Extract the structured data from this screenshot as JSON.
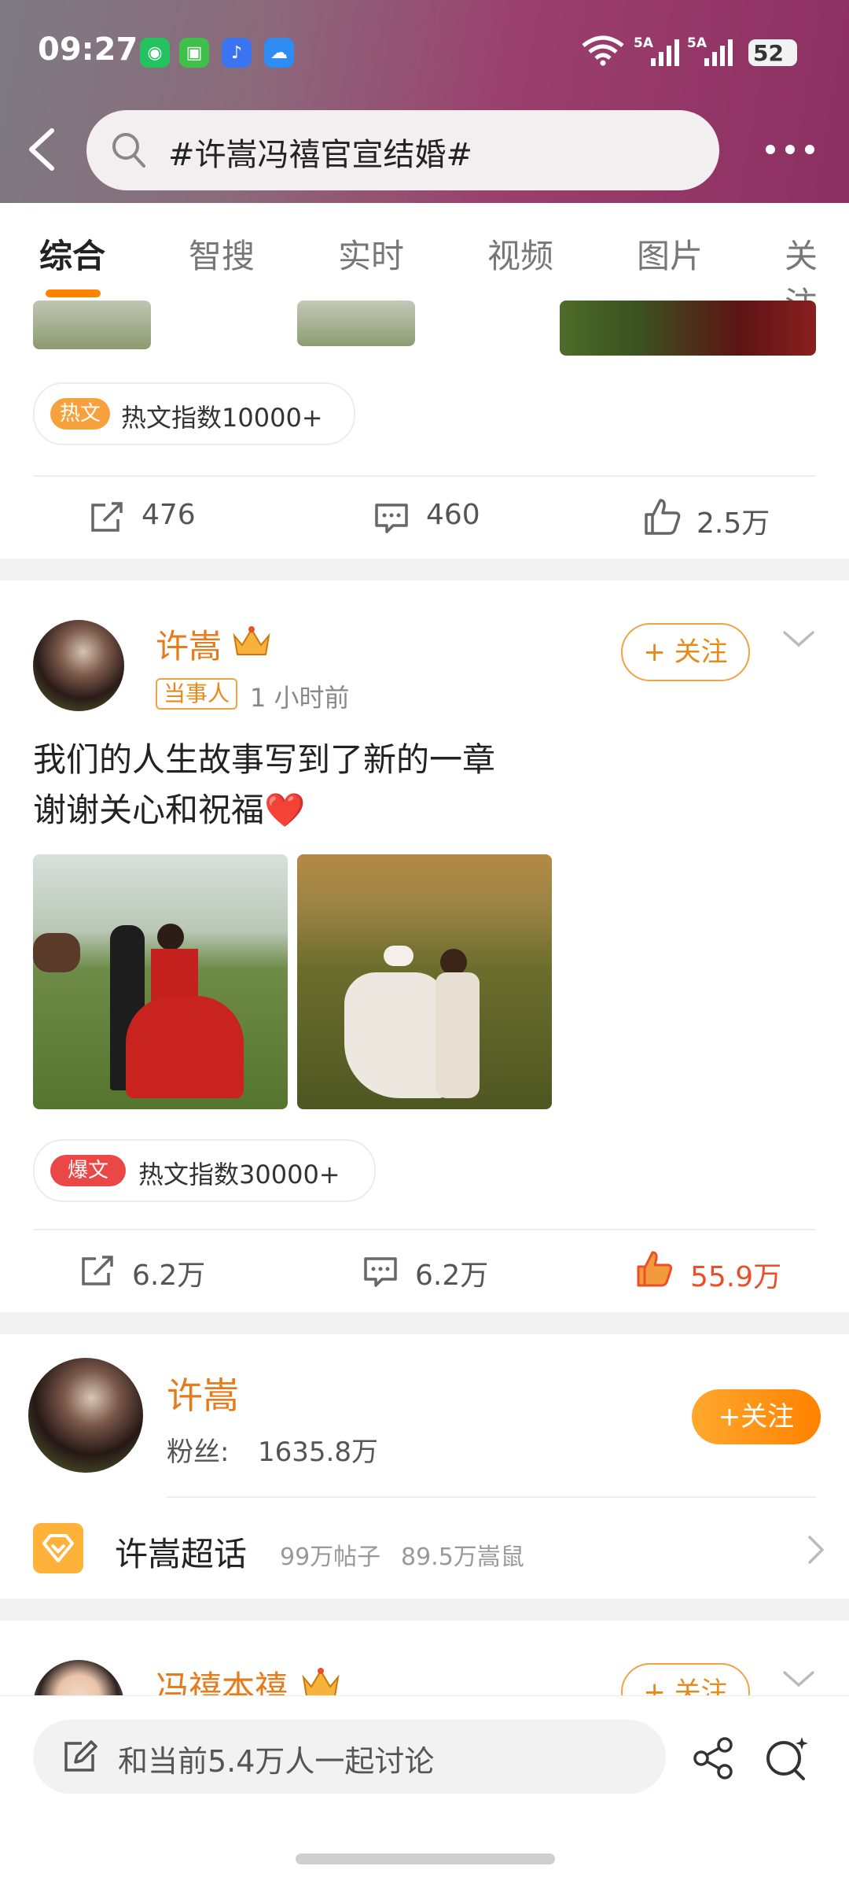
{
  "status_bar": {
    "time": "09:27",
    "battery": "52"
  },
  "search": {
    "query": "#许嵩冯禧官宣结婚#"
  },
  "tabs": [
    "综合",
    "智搜",
    "实时",
    "视频",
    "图片",
    "关注"
  ],
  "post1": {
    "hot_badge": "热文",
    "hot_text": "热文指数10000+",
    "reposts": "476",
    "comments": "460",
    "likes": "2.5万"
  },
  "post2": {
    "author": "许嵩",
    "tag": "当事人",
    "time": "1 小时前",
    "follow_label": "+ 关注",
    "text_line1": "我们的人生故事写到了新的一章",
    "text_line2": "谢谢关心和祝福❤️",
    "hot_badge": "爆文",
    "hot_text": "热文指数30000+",
    "reposts": "6.2万",
    "comments": "6.2万",
    "likes": "55.9万"
  },
  "user_card": {
    "name": "许嵩",
    "fans_label": "粉丝:",
    "fans_count": "1635.8万",
    "follow_label": "+关注",
    "super_topic": "许嵩超话",
    "posts": "99万帖子",
    "members": "89.5万嵩鼠"
  },
  "post3": {
    "author": "冯禧本禧",
    "follow_label": "+ 关注"
  },
  "bottom": {
    "discuss_placeholder": "和当前5.4万人一起讨论"
  },
  "colors": {
    "accent": "#ff8200",
    "name_orange": "#e77b1b",
    "like_active": "#e9502a"
  }
}
